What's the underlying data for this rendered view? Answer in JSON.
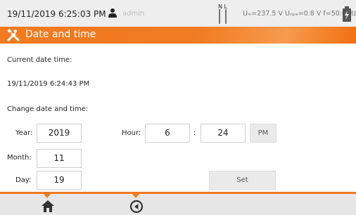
{
  "status_bar": {
    "datetime": "19/11/2019 6:25:03 PM",
    "user": "admin",
    "plug_labels": "N L",
    "measurements": "Uₗₙ=237.5 V Uₙₚₑ=0.8 V f=50.0 Hz",
    "icons": [
      "user-icon",
      "plug-icon",
      "battery-icon"
    ]
  },
  "title": "Date and time",
  "current": {
    "label": "Current date time:",
    "value": "19/11/2019 6:24:43 PM"
  },
  "change": {
    "label": "Change date and time:",
    "year_label": "Year:",
    "year": "2019",
    "month_label": "Month:",
    "month": "11",
    "day_label": "Day:",
    "day": "19",
    "hour_label": "Hour:",
    "hour": "6",
    "separator": ":",
    "minute": "24",
    "ampm": "PM",
    "set_label": "Set"
  },
  "bottom_nav": {
    "icons": [
      "home-icon",
      "back-icon"
    ]
  },
  "colors": {
    "accent": "#f07b22",
    "statusbar_bg": "#eeeeee",
    "bottombar_bg": "#e6e6e6"
  }
}
